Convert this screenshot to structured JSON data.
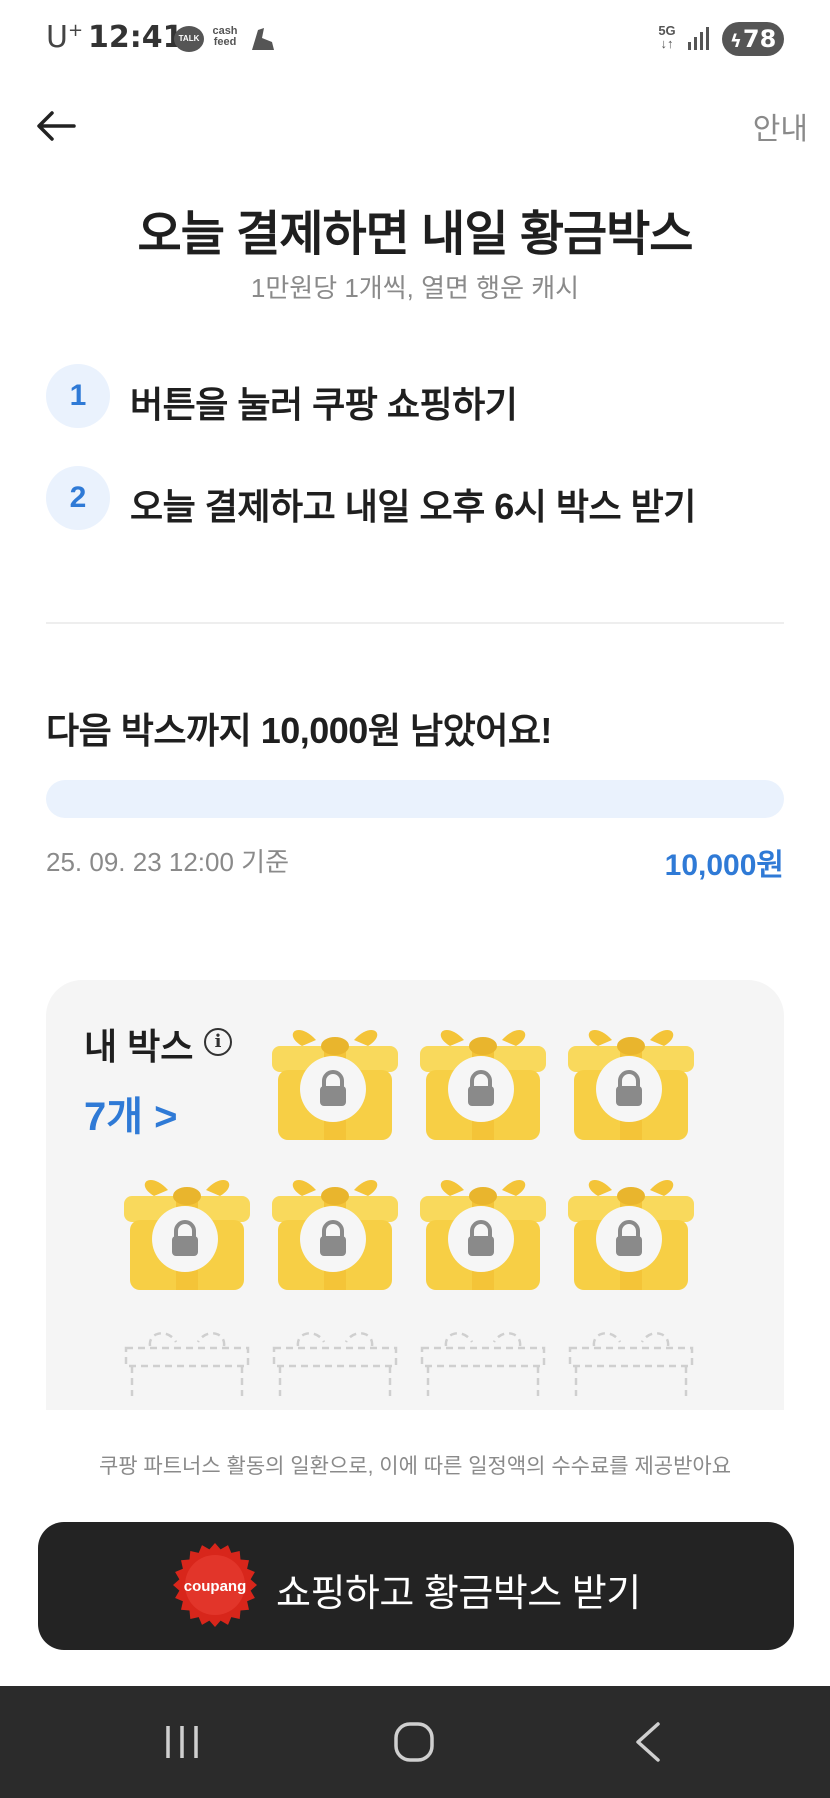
{
  "status_bar": {
    "carrier": "U",
    "carrier_plus": "+",
    "time": "12:41",
    "talk_label": "TALK",
    "cashfeed_label_1": "cash",
    "cashfeed_label_2": "feed",
    "network": "5G",
    "battery": "78"
  },
  "header": {
    "guide_label": "안내"
  },
  "hero": {
    "title": "오늘 결제하면 내일 황금박스",
    "subtitle": "1만원당 1개씩, 열면 행운 캐시"
  },
  "steps": [
    {
      "num": "1",
      "text": "버튼을 눌러 쿠팡 쇼핑하기"
    },
    {
      "num": "2",
      "text": "오늘 결제하고 내일 오후 6시 박스 받기"
    }
  ],
  "progress": {
    "title": "다음 박스까지 10,000원 남았어요!",
    "as_of": "25. 09. 23 12:00 기준",
    "remaining": "10,000원",
    "fill_fraction": 0
  },
  "my_box": {
    "label": "내 박스",
    "info_icon": "i",
    "count": "7개 >",
    "locked_boxes": 7,
    "empty_slots": 4
  },
  "footer": {
    "disclaimer": "쿠팡 파트너스 활동의 일환으로, 이에 따른 일정액의 수수료를 제공받아요",
    "cta_badge": "coupang",
    "cta_label": "쇼핑하고 황금박스 받기"
  },
  "colors": {
    "accent": "#2f7ad6",
    "accent_light": "#eaf2fd",
    "gold": "#f7cf45",
    "cta_bg": "#232323",
    "badge_red": "#d8261b"
  }
}
